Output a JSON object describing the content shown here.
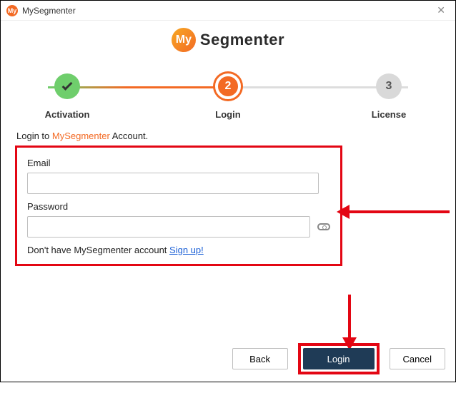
{
  "window": {
    "title": "MySegmenter"
  },
  "brand": {
    "logo_text": "My",
    "name": "Segmenter"
  },
  "stepper": {
    "steps": [
      {
        "label": "Activation",
        "badge": ""
      },
      {
        "label": "Login",
        "badge": "2"
      },
      {
        "label": "License",
        "badge": "3"
      }
    ]
  },
  "instruction": {
    "prefix": "Login to ",
    "highlight": "MySegmenter",
    "suffix": " Account."
  },
  "form": {
    "email_label": "Email",
    "email_value": "",
    "password_label": "Password",
    "password_value": "",
    "signup_prefix": "Don't have MySegmenter account ",
    "signup_link": "Sign up!"
  },
  "footer": {
    "back": "Back",
    "login": "Login",
    "cancel": "Cancel"
  }
}
